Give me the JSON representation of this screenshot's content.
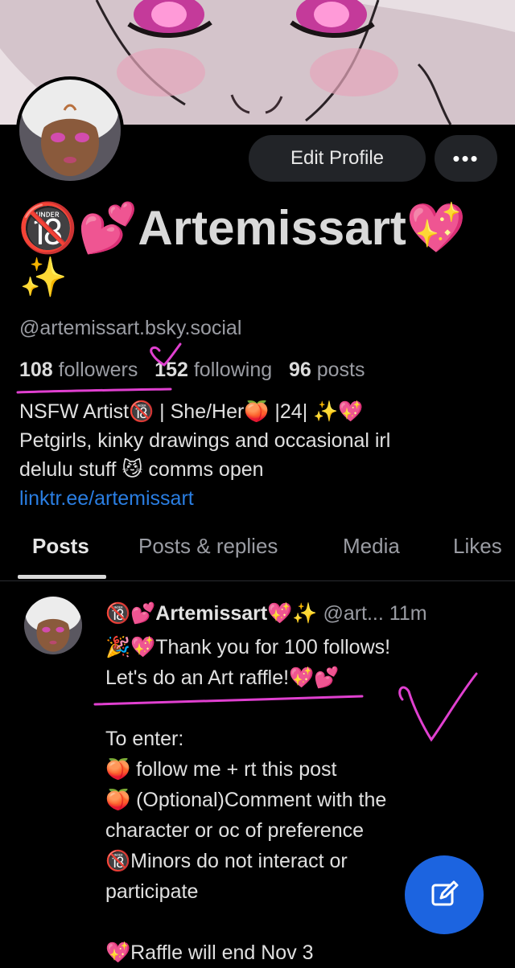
{
  "profile": {
    "display_name": "Artemissart",
    "name_prefix_emoji": "🔞💕",
    "name_suffix_emoji": "💖",
    "sparkle": "✨",
    "handle": "@artemissart.bsky.social",
    "followers_count": "108",
    "followers_label": "followers",
    "following_count": "152",
    "following_label": "following",
    "posts_count": "96",
    "posts_label": "posts",
    "bio_line1": "NSFW Artist🔞 | She/Her🍑 |24| ✨💖",
    "bio_line2": "Petgirls, kinky drawings and occasional irl",
    "bio_line3": "delulu stuff 😼 comms open",
    "bio_link": "linktr.ee/artemissart"
  },
  "actions": {
    "edit_profile_label": "Edit Profile",
    "more_label": "•••"
  },
  "tabs": [
    "Posts",
    "Posts & replies",
    "Media",
    "Likes"
  ],
  "post": {
    "author_prefix": "🔞💕",
    "author_name": "Artemissart",
    "author_suffix": "💖✨",
    "handle": "@art...",
    "time": "11m",
    "lines": [
      "🎉💖Thank you for 100 follows!",
      "Let's do an Art raffle!💖💕",
      "",
      "To enter:",
      "🍑 follow me + rt this post",
      "🍑 (Optional)Comment with the",
      "character or oc of preference",
      "🔞Minors do not interact or",
      "participate",
      "",
      "💖Raffle will end Nov 3"
    ]
  },
  "colors": {
    "background": "#000000",
    "link": "#2a7ee2",
    "fab": "#1c64e0",
    "annotation": "#e040d0"
  },
  "icons": {
    "fab": "compose-icon",
    "more": "more-dots-icon"
  }
}
